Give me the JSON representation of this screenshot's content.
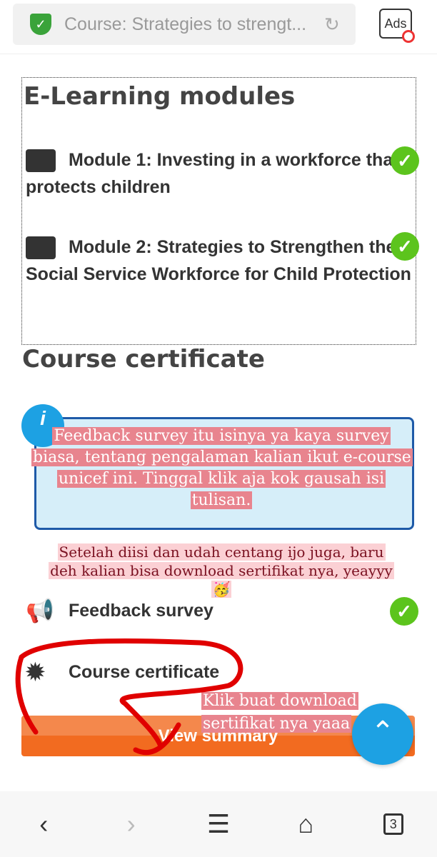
{
  "browser": {
    "url_text": "Course: Strategies to strengt...",
    "ads_label": "Ads",
    "tab_count": "3"
  },
  "modules": {
    "title": "E-Learning modules",
    "items": [
      {
        "label": "Module 1: Investing in a workforce that protects children",
        "completed": true
      },
      {
        "label": "Module 2: Strategies to Strengthen the Social Service Workforce for Child Protection",
        "completed": true
      }
    ]
  },
  "certificate": {
    "title": "Course certificate",
    "activities": [
      {
        "label": "Feedback survey",
        "icon": "megaphone-icon",
        "completed": true
      },
      {
        "label": "Course certificate",
        "icon": "badge-icon"
      }
    ],
    "button": "View summary"
  },
  "annotations": {
    "note1": "Feedback survey itu isinya ya kaya survey biasa, tentang pengalaman kalian ikut e-course unicef ini. Tinggal klik aja kok gausah isi tulisan.",
    "note2": "Setelah diisi dan udah centang ijo juga, baru deh kalian bisa download sertifikat nya, yeayyy🥳",
    "note3": "Klik buat download sertifikat nya yaaa"
  },
  "colors": {
    "accent": "#f26b20",
    "info": "#1da1e3",
    "check": "#5cc41d",
    "annotation": "#e8848e",
    "circle": "#e00000"
  }
}
